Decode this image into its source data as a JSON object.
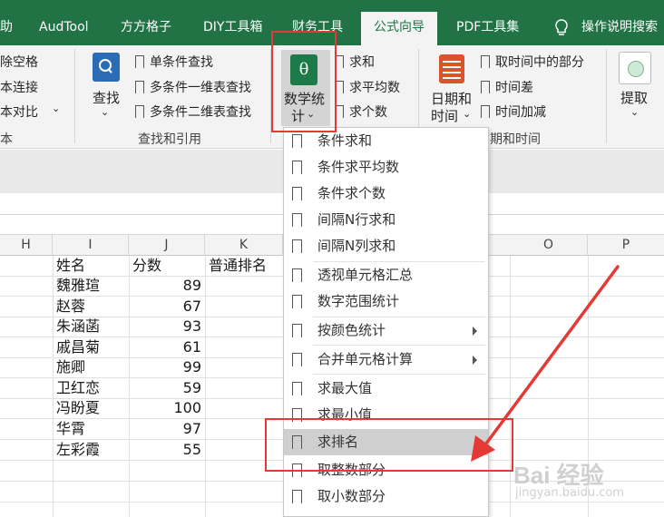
{
  "tabs": [
    "助",
    "AudTool",
    "方方格子",
    "DIY工具箱",
    "财务工具",
    "公式向导",
    "PDF工具集"
  ],
  "help_text": "操作说明搜索",
  "ribbon": {
    "group1_items": [
      "除空格",
      "本连接",
      "本对比"
    ],
    "group1_label": "本",
    "find_label": "查找",
    "find_items": [
      "单条件查找",
      "多条件一维表查找",
      "多条件二维表查找"
    ],
    "group2_label": "查找和引用",
    "math_label_1": "数学统",
    "math_label_2": "计",
    "math_items": [
      "求和",
      "求平均数",
      "求个数"
    ],
    "date_label_1": "日期和",
    "date_label_2": "时间",
    "date_items": [
      "取时间中的部分",
      "时间差",
      "时间加减"
    ],
    "group3_label": "期和时间",
    "extract_label": "提取",
    "theta": "θ"
  },
  "columns": [
    "H",
    "I",
    "J",
    "K",
    "O",
    "P"
  ],
  "table": {
    "headers": [
      "姓名",
      "分数",
      "普通排名"
    ],
    "rows": [
      {
        "name": "魏雅瑄",
        "score": "89"
      },
      {
        "name": "赵蓉",
        "score": "67"
      },
      {
        "name": "朱涵菡",
        "score": "93"
      },
      {
        "name": "戚昌菊",
        "score": "61"
      },
      {
        "name": "施卿",
        "score": "99"
      },
      {
        "name": "卫红恋",
        "score": "59"
      },
      {
        "name": "冯盼夏",
        "score": "100"
      },
      {
        "name": "华霄",
        "score": "97"
      },
      {
        "name": "左彩霞",
        "score": "55"
      }
    ]
  },
  "menu": {
    "items": [
      {
        "label": "条件求和"
      },
      {
        "label": "条件求平均数"
      },
      {
        "label": "条件求个数"
      },
      {
        "label": "间隔N行求和"
      },
      {
        "label": "间隔N列求和"
      },
      {
        "label": "透视单元格汇总"
      },
      {
        "label": "数字范围统计"
      },
      {
        "label": "按颜色统计"
      },
      {
        "label": "合并单元格计算"
      },
      {
        "label": "求最大值"
      },
      {
        "label": "求最小值"
      },
      {
        "label": "求排名"
      },
      {
        "label": "取整数部分"
      },
      {
        "label": "取小数部分"
      }
    ],
    "highlighted": "求排名"
  },
  "watermark": {
    "main": "Bai 经验",
    "sub": "jingyan.baidu.com"
  },
  "colors": {
    "accent": "#217346",
    "annotation": "#e53935",
    "highlight": "#cfcfcf"
  }
}
